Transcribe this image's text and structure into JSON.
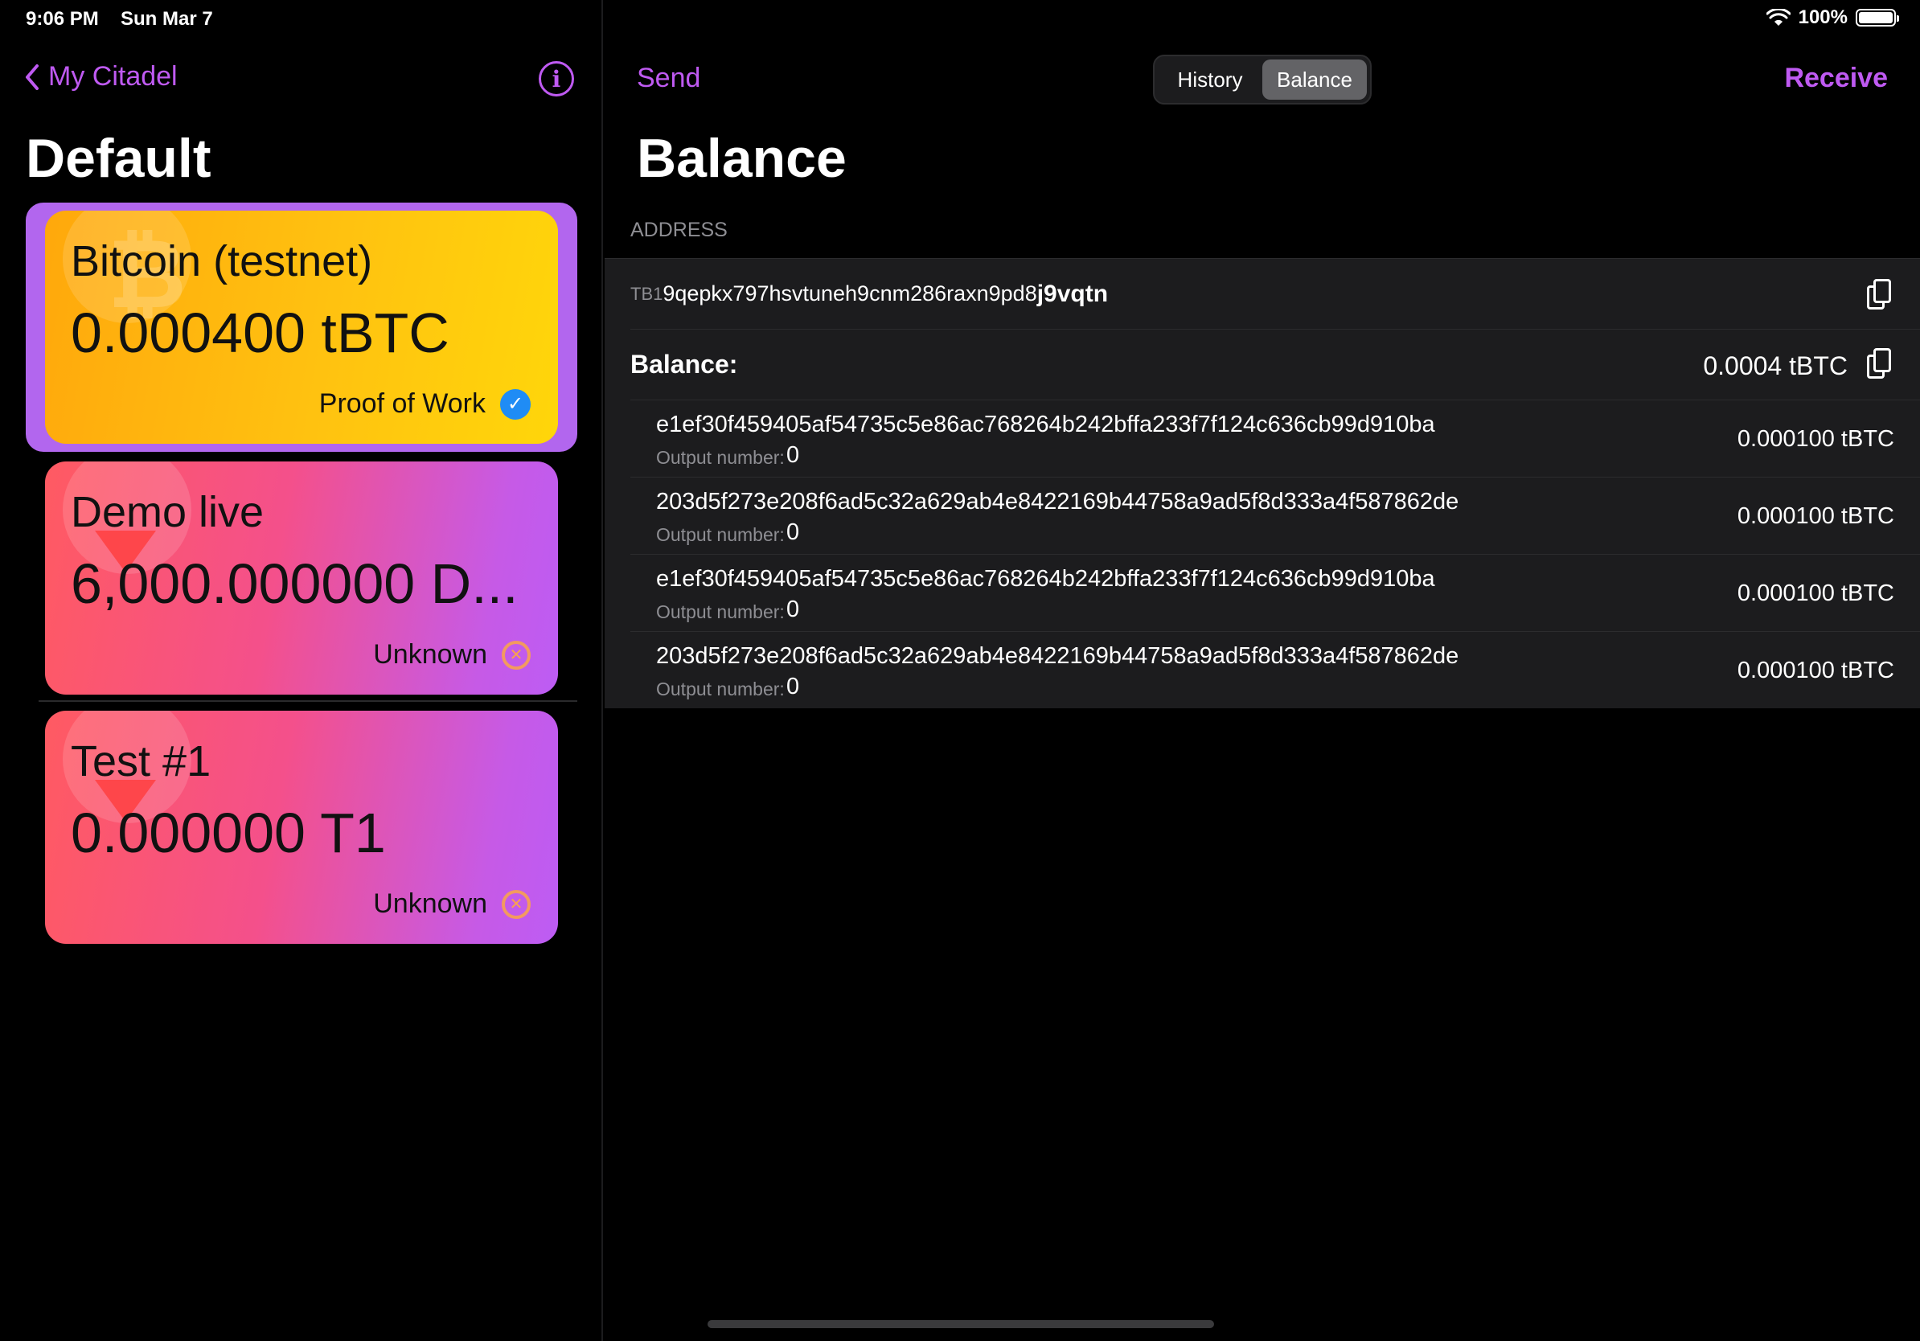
{
  "status_bar": {
    "time": "9:06 PM",
    "date": "Sun Mar 7",
    "battery_percent": "100%",
    "wifi_icon": "wifi-icon"
  },
  "sidebar": {
    "back_label": "My Citadel",
    "title": "Default",
    "assets": [
      {
        "name": "Bitcoin (testnet)",
        "amount": "0.000400 tBTC",
        "consensus": "Proof of Work",
        "badge": "verified-badge-icon",
        "selected": true,
        "watermark": "₿"
      },
      {
        "name": "Demo live",
        "amount": "6,000.000000 D...",
        "consensus": "Unknown",
        "badge": "unknown-badge-icon",
        "selected": false
      },
      {
        "name": "Test #1",
        "amount": "0.000000 T1",
        "consensus": "Unknown",
        "badge": "unknown-badge-icon",
        "selected": false
      }
    ]
  },
  "main": {
    "send_label": "Send",
    "receive_label": "Receive",
    "tabs": [
      {
        "label": "History",
        "active": false
      },
      {
        "label": "Balance",
        "active": true
      }
    ],
    "title": "Balance",
    "address_section_header": "ADDRESS",
    "address": {
      "prefix": "TB1",
      "middle": "9qepkx797hsvtuneh9cnm286raxn9pd8",
      "tail": "j9vqtn"
    },
    "balance_label": "Balance:",
    "balance_value": "0.0004 tBTC",
    "output_label": "Output number:",
    "utxos": [
      {
        "txid": "e1ef30f459405af54735c5e86ac768264b242bffa233f7f124c636cb99d910ba",
        "output": "0",
        "amount": "0.000100 tBTC"
      },
      {
        "txid": "203d5f273e208f6ad5c32a629ab4e8422169b44758a9ad5f8d333a4f587862de",
        "output": "0",
        "amount": "0.000100 tBTC"
      },
      {
        "txid": "e1ef30f459405af54735c5e86ac768264b242bffa233f7f124c636cb99d910ba",
        "output": "0",
        "amount": "0.000100 tBTC"
      },
      {
        "txid": "203d5f273e208f6ad5c32a629ab4e8422169b44758a9ad5f8d333a4f587862de",
        "output": "0",
        "amount": "0.000100 tBTC"
      }
    ]
  },
  "colors": {
    "accent": "#bf5af2",
    "background": "#000000",
    "row_background": "#1c1c1e",
    "secondary_text": "#8e8e93"
  }
}
